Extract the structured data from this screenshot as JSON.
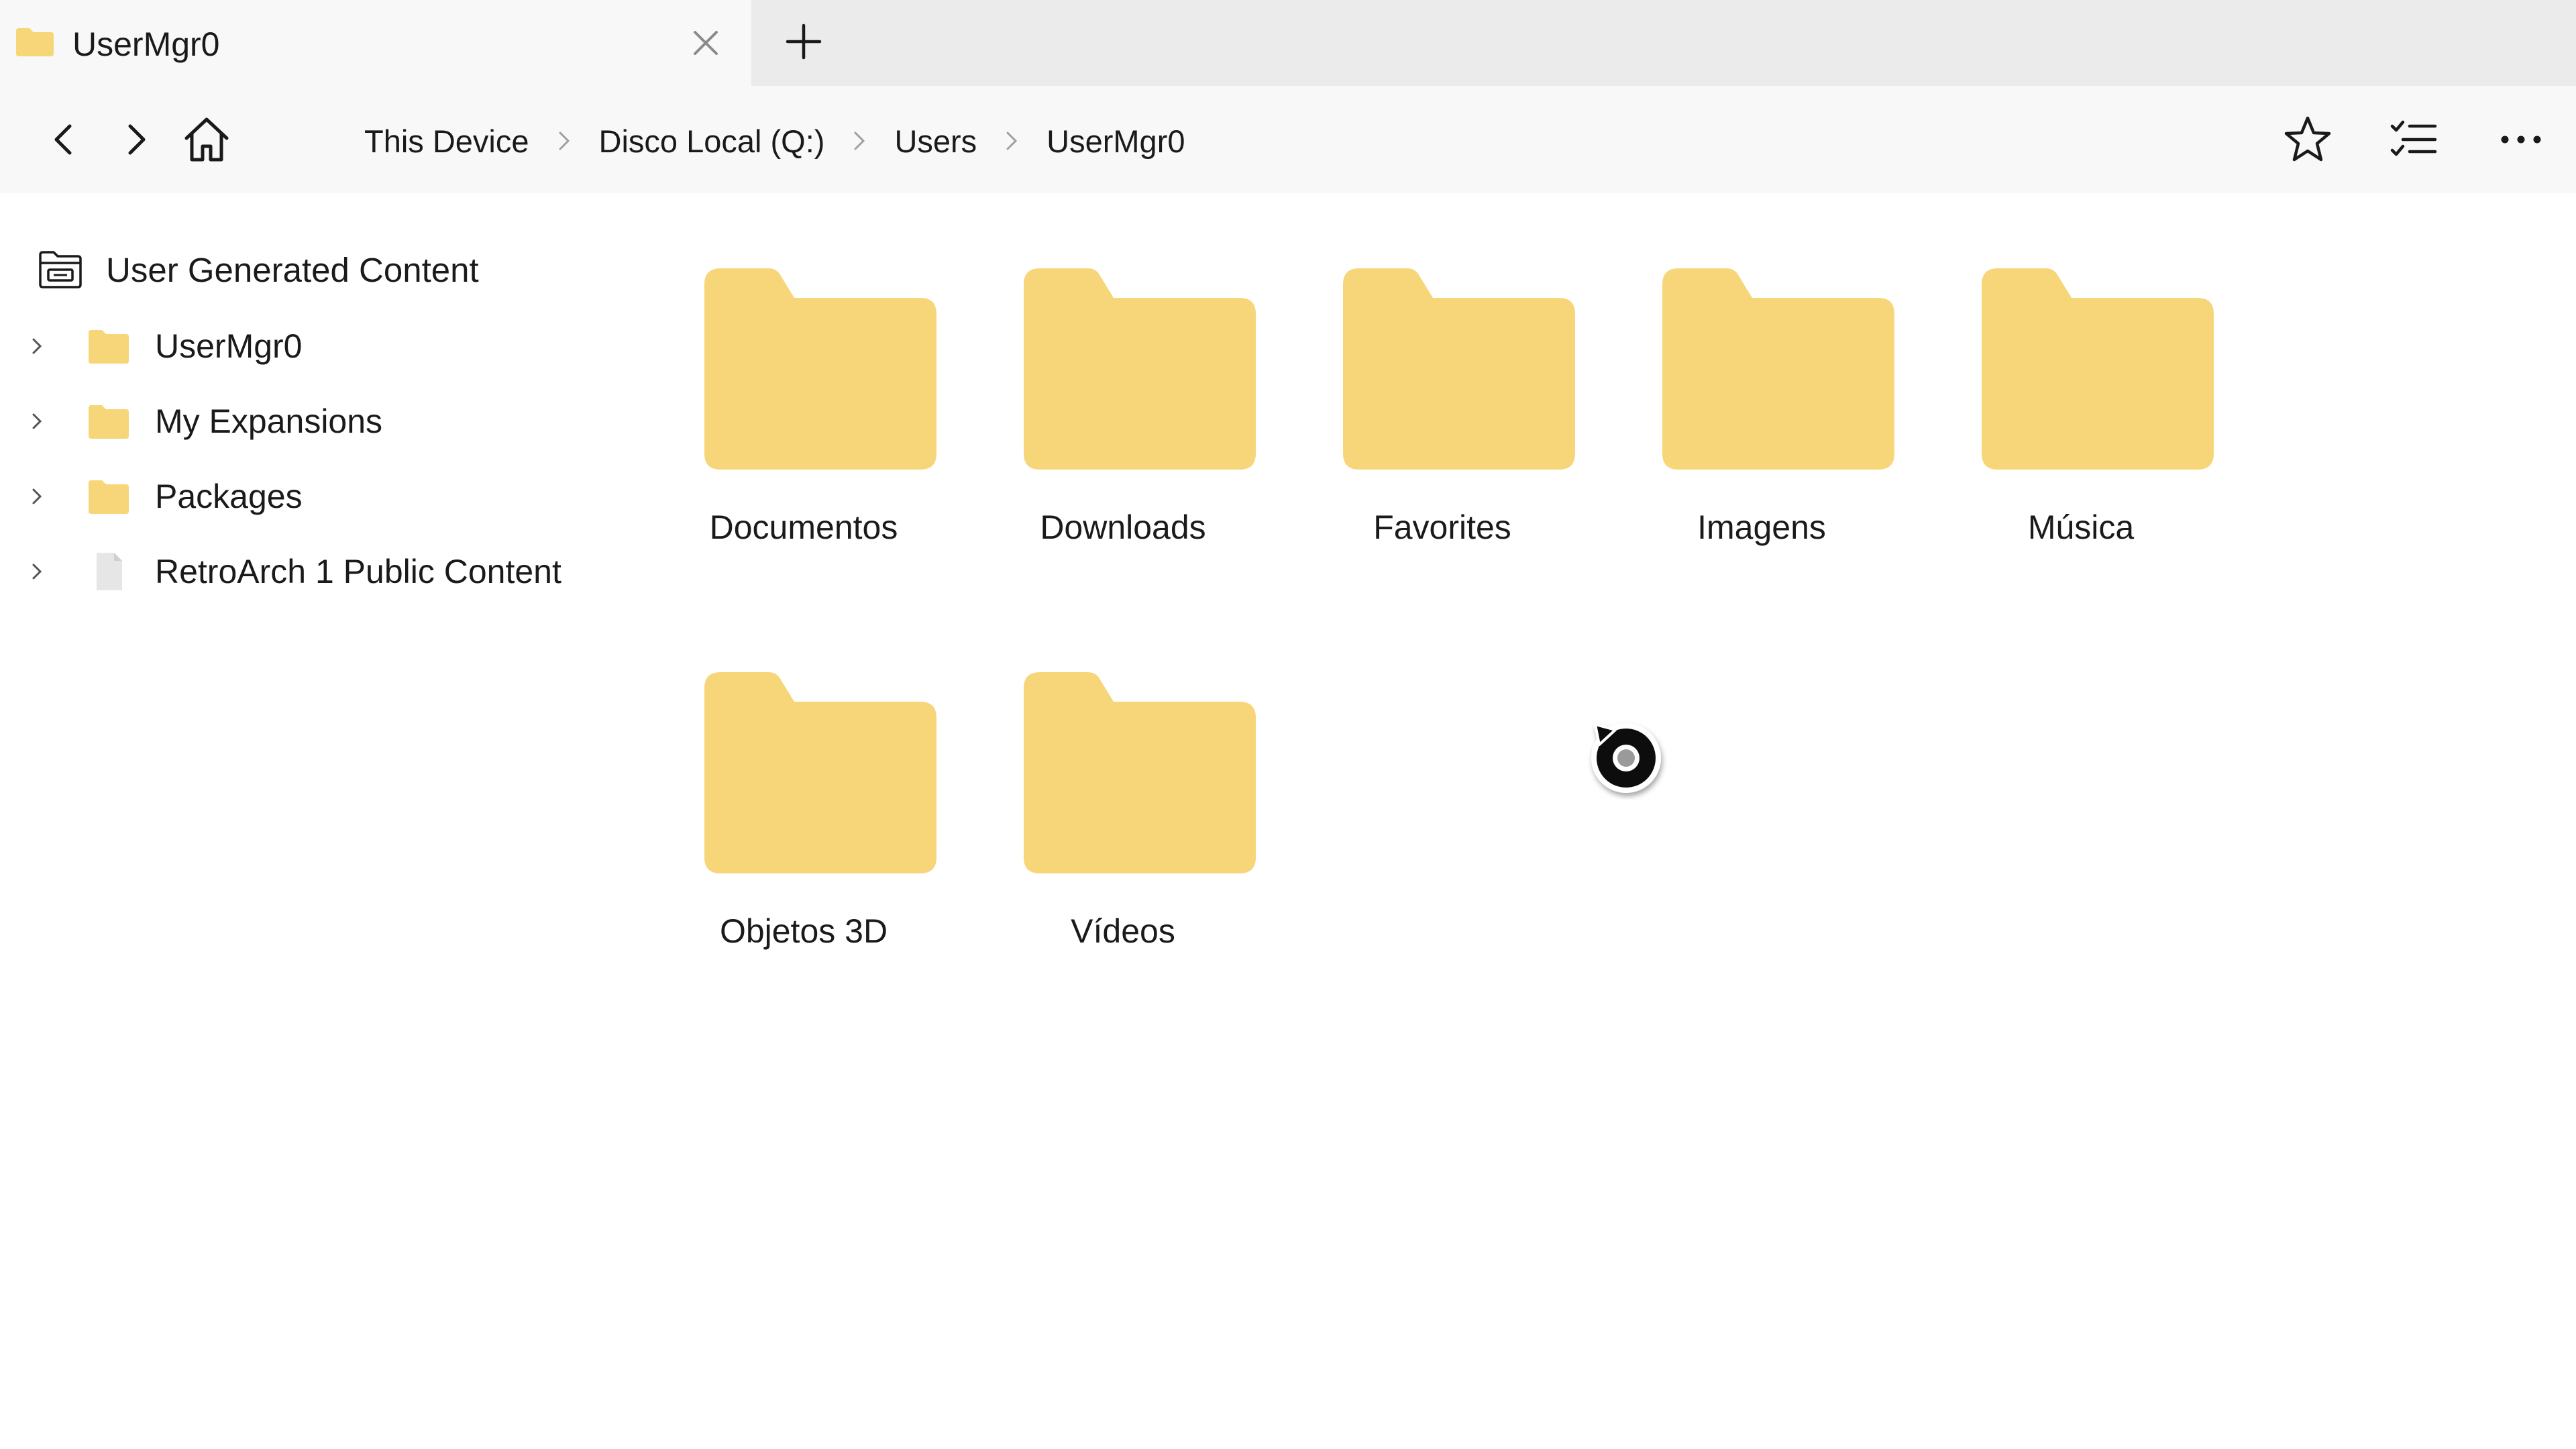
{
  "tab": {
    "title": "UserMgr0"
  },
  "breadcrumb": [
    "This Device",
    "Disco Local (Q:)",
    "Users",
    "UserMgr0"
  ],
  "sidebar": {
    "header_label": "User Generated Content",
    "items": [
      {
        "label": "UserMgr0",
        "icon": "folder-icon"
      },
      {
        "label": "My Expansions",
        "icon": "folder-icon"
      },
      {
        "label": "Packages",
        "icon": "folder-icon"
      },
      {
        "label": "RetroArch 1 Public Content",
        "icon": "file-icon"
      }
    ]
  },
  "folders": [
    {
      "name": "Documentos"
    },
    {
      "name": "Downloads"
    },
    {
      "name": "Favorites"
    },
    {
      "name": "Imagens"
    },
    {
      "name": "Música"
    },
    {
      "name": "Objetos 3D"
    },
    {
      "name": "Vídeos"
    }
  ],
  "colors": {
    "folder": "#f7d67a",
    "tabstrip_bg": "#ebebeb",
    "toolbar_bg": "#f8f8f8",
    "content_bg": "#ffffff"
  }
}
